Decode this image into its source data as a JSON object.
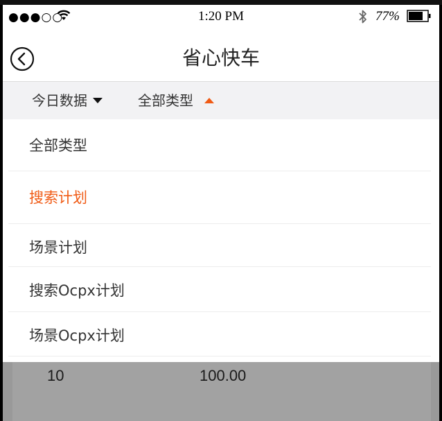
{
  "status_bar": {
    "signal": "●●●○○",
    "time": "1:20 PM",
    "battery_percent": "77%",
    "battery_level": 0.77
  },
  "nav": {
    "title": "省心快车"
  },
  "filters": {
    "date_label": "今日数据",
    "type_label": "全部类型"
  },
  "dropdown": {
    "options": [
      {
        "label": "全部类型",
        "selected": false
      },
      {
        "label": "搜索计划",
        "selected": true
      },
      {
        "label": "场景计划",
        "selected": false
      },
      {
        "label": "搜索Ocpx计划",
        "selected": false
      },
      {
        "label": "场景Ocpx计划",
        "selected": false
      }
    ]
  },
  "table_row": {
    "col1": "10",
    "col2": "100.00"
  },
  "colors": {
    "accent": "#f05a14"
  }
}
